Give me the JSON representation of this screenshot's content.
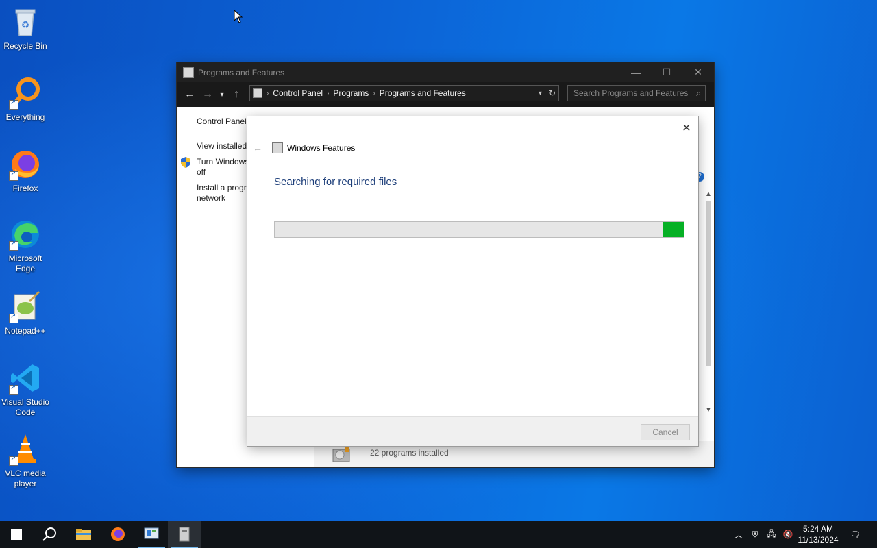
{
  "desktop": {
    "icons": [
      {
        "label": "Recycle Bin"
      },
      {
        "label": "Everything"
      },
      {
        "label": "Firefox"
      },
      {
        "label": "Microsoft Edge"
      },
      {
        "label": "Notepad++"
      },
      {
        "label": "Visual Studio Code"
      },
      {
        "label": "VLC media player"
      }
    ]
  },
  "window": {
    "title": "Programs and Features",
    "breadcrumb": [
      "Control Panel",
      "Programs",
      "Programs and Features"
    ],
    "search_placeholder": "Search Programs and Features",
    "left_links": [
      "Control Panel",
      "View installed",
      "Turn Windows\noff",
      "Install a progra\nnetwork"
    ],
    "status_text": "22 programs installed"
  },
  "dialog": {
    "title": "Windows Features",
    "message": "Searching for required files",
    "progress": 0.05,
    "progress_fill_start": 0.95,
    "cancel_label": "Cancel"
  },
  "taskbar": {
    "time": "5:24 AM",
    "date": "11/13/2024"
  },
  "colors": {
    "accent_progress": "#06b025",
    "titlebar": "#202020",
    "heading_blue": "#1e3f7a"
  }
}
